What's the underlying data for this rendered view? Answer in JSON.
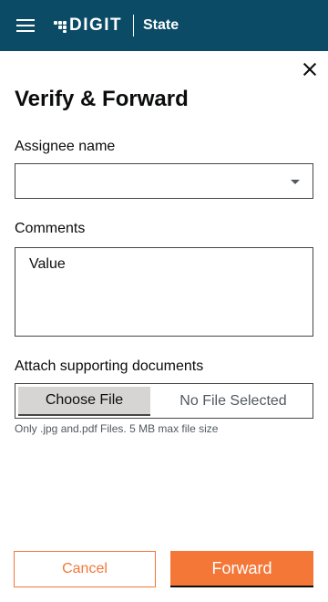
{
  "header": {
    "logo_text": "DIGIT",
    "state_label": "State",
    "background_color": "#0b4b66",
    "menu_icon": "hamburger-icon",
    "logo_icon": "digit-logo-mark"
  },
  "dialog": {
    "title": "Verify & Forward",
    "close_icon": "close-icon"
  },
  "form": {
    "assignee_label": "Assignee name",
    "assignee_value": "",
    "assignee_dropdown_icon": "caret-down-icon",
    "comments_label": "Comments",
    "comments_value": "Value",
    "attach_label": "Attach supporting documents",
    "choose_file_label": "Choose File",
    "no_file_text": "No File Selected",
    "file_hint": "Only .jpg and.pdf Files. 5 MB max file size"
  },
  "actions": {
    "cancel_label": "Cancel",
    "forward_label": "Forward",
    "accent_color": "#f47738"
  }
}
